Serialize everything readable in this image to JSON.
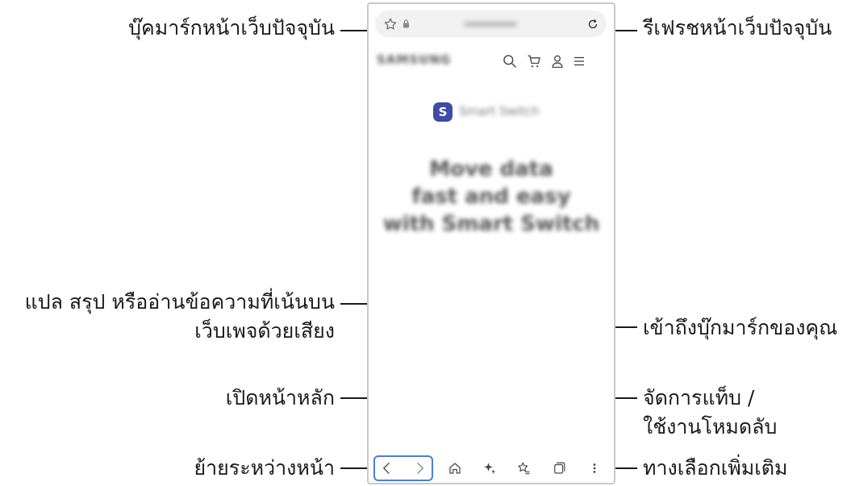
{
  "callouts": {
    "bookmark_current": "บุ๊คมาร์กหน้าเว็บปัจจุบัน",
    "refresh": "รีเฟรชหน้าเว็บปัจจุบัน",
    "translate_line1": "แปล สรุป หรืออ่านข้อความที่เน้นบน",
    "translate_line2": "เว็บเพจด้วยเสียง",
    "bookmarks_access": "เข้าถึงบุ๊กมาร์กของคุณ",
    "home": "เปิดหน้าหลัก",
    "tabs_line1": "จัดการแท็บ /",
    "tabs_line2": "ใช้งานโหมดลับ",
    "navigate": "ย้ายระหว่างหน้า",
    "more_options": "ทางเลือกเพิ่มเติม"
  },
  "page": {
    "headline_line1": "Move data",
    "headline_line2": "fast and easy",
    "headline_line3": "with Smart Switch",
    "app_badge_letter": "S",
    "app_name": "Smart Switch",
    "brand": "SAMSUNG"
  },
  "icons": [
    "star-icon",
    "lock-icon",
    "refresh-icon",
    "search-icon",
    "cart-icon",
    "user-icon",
    "menu-icon",
    "back-icon",
    "forward-icon",
    "home-icon",
    "ai-sparkle-icon",
    "bookmarks-icon",
    "tabs-icon",
    "more-icon"
  ],
  "colors": {
    "leader": "#1a1a1a",
    "phone_border": "#c9c9c9",
    "badge": "#3d4ca8"
  }
}
